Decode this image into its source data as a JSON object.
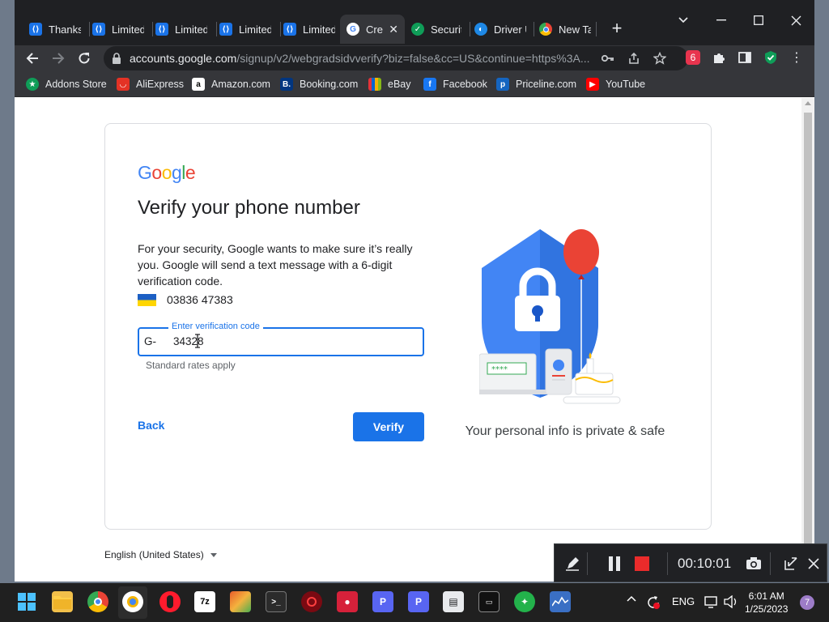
{
  "browser": {
    "tabs": [
      {
        "label": "Thanks",
        "icon": "blue-bracket-icon",
        "color": "#1a73e8"
      },
      {
        "label": "Limited",
        "icon": "blue-bracket-icon",
        "color": "#1a73e8"
      },
      {
        "label": "Limited",
        "icon": "blue-bracket-icon",
        "color": "#1a73e8"
      },
      {
        "label": "Limited",
        "icon": "blue-bracket-icon",
        "color": "#1a73e8"
      },
      {
        "label": "Limited",
        "icon": "blue-bracket-icon",
        "color": "#1a73e8"
      },
      {
        "label": "Cre",
        "icon": "google-icon",
        "color": "#ffffff"
      },
      {
        "label": "Security",
        "icon": "shield-check-icon",
        "color": "#0f9d58"
      },
      {
        "label": "Driver U",
        "icon": "driver-updater-icon",
        "color": "#1e88e5"
      },
      {
        "label": "New Ta",
        "icon": "chrome-icon",
        "color": "#ffffff"
      }
    ],
    "url_host": "accounts.google.com",
    "url_path": "/signup/v2/webgradsidvverify?biz=false&cc=US&continue=https%3A...",
    "bookmarks": [
      {
        "label": "Addons Store",
        "icon": "addons-store-icon",
        "color": "#0f9d58"
      },
      {
        "label": "AliExpress",
        "icon": "aliexpress-icon",
        "color": "#e43225"
      },
      {
        "label": "Amazon.com",
        "icon": "amazon-icon",
        "color": "#ffffff"
      },
      {
        "label": "Booking.com",
        "icon": "booking-icon",
        "color": "#003580"
      },
      {
        "label": "eBay",
        "icon": "ebay-icon",
        "color": "#e53238"
      },
      {
        "label": "Facebook",
        "icon": "facebook-icon",
        "color": "#1877f2"
      },
      {
        "label": "Priceline.com",
        "icon": "priceline-icon",
        "color": "#1565c0"
      },
      {
        "label": "YouTube",
        "icon": "youtube-icon",
        "color": "#ff0000"
      }
    ]
  },
  "page": {
    "logo_text": "Google",
    "heading": "Verify your phone number",
    "intro": "For your security, Google wants to make sure it’s really you. Google will send a text message with a 6-digit verification code.",
    "phone_number": "03836 47383",
    "code_field": {
      "label": "Enter verification code",
      "prefix": "G-",
      "value": "34328"
    },
    "helper_text": "Standard rates apply",
    "back_label": "Back",
    "verify_label": "Verify",
    "privacy_caption": "Your personal info is private & safe",
    "language": "English (United States)",
    "accent_color": "#1a73e8"
  },
  "recorder": {
    "elapsed": "00:10:01"
  },
  "taskbar": {
    "language": "ENG",
    "time": "6:01 AM",
    "date": "1/25/2023",
    "notification_count": "7"
  }
}
